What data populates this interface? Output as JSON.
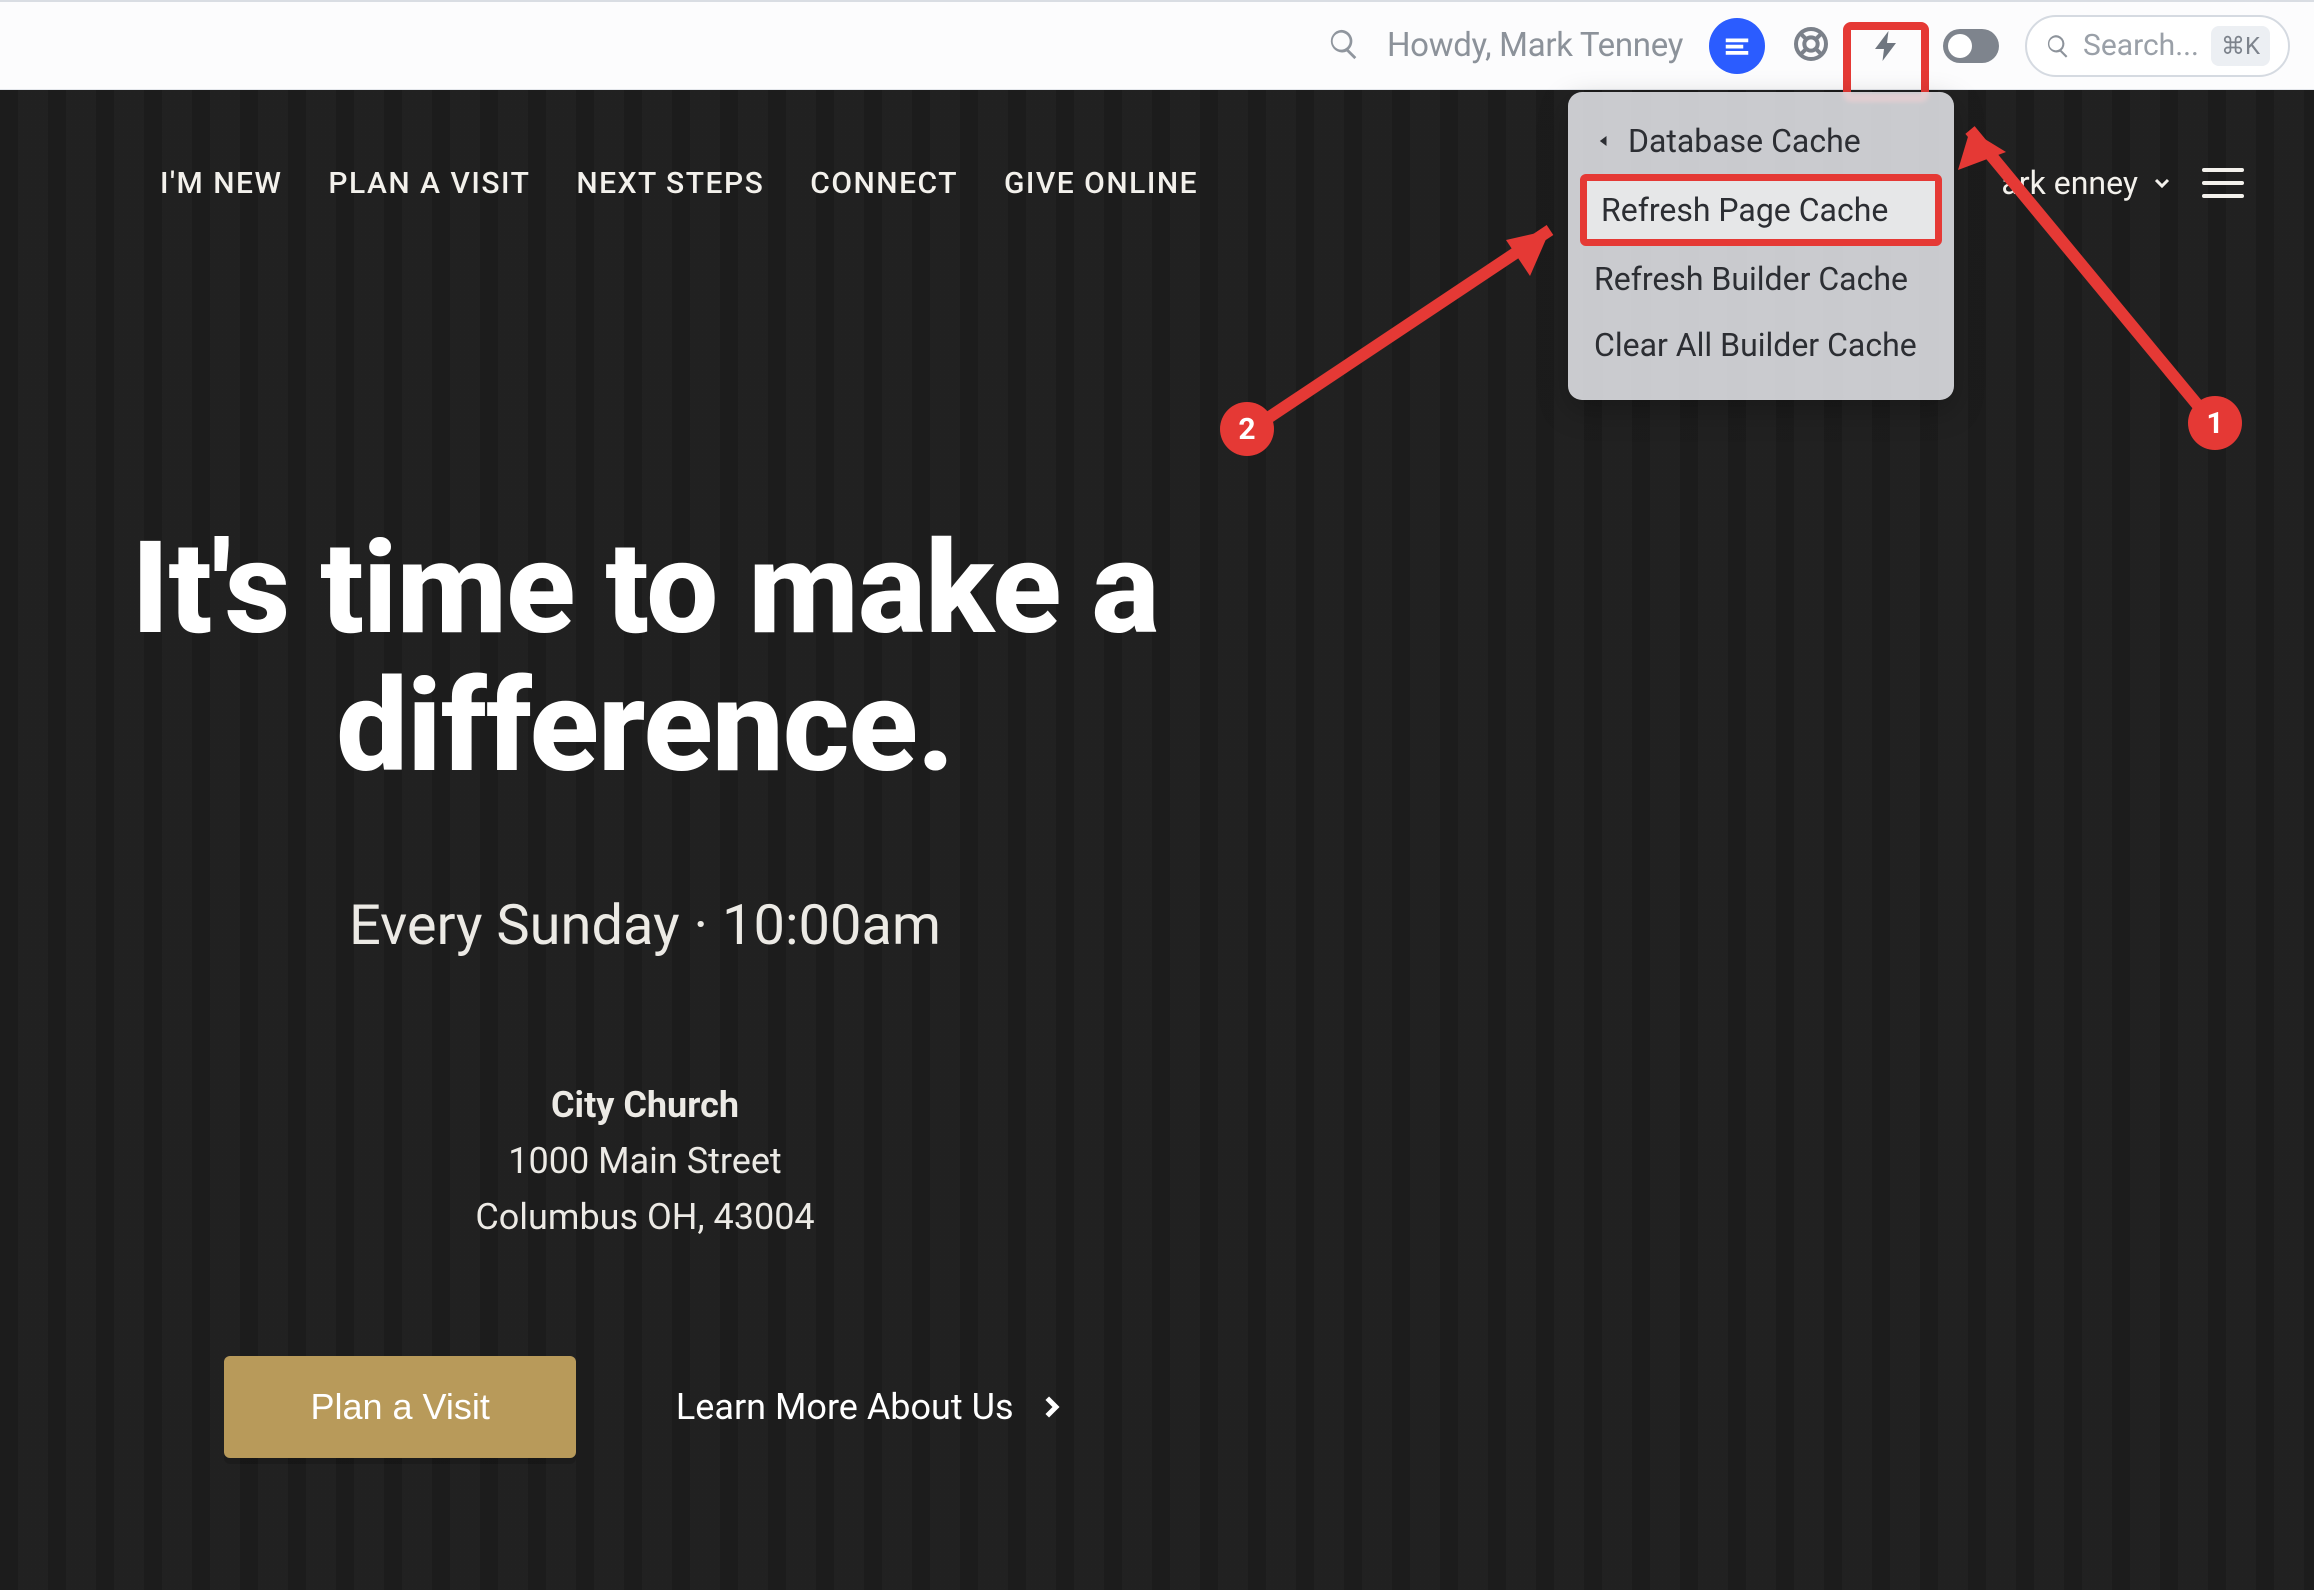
{
  "adminbar": {
    "howdy": "Howdy, Mark Tenney",
    "search_placeholder": "Search...",
    "kbd": "⌘K"
  },
  "dropdown": {
    "back_label": "Database Cache",
    "items": [
      "Refresh Page Cache",
      "Refresh Builder Cache",
      "Clear All Builder Cache"
    ]
  },
  "sitenav": {
    "items": [
      "I'M NEW",
      "PLAN A VISIT",
      "NEXT STEPS",
      "CONNECT",
      "GIVE ONLINE"
    ],
    "user_partial": "ark   enney"
  },
  "hero": {
    "headline": "It's time to make a difference.",
    "subhead": "Every Sunday · 10:00am",
    "church_name": "City Church",
    "addr1": "1000 Main Street",
    "addr2": "Columbus OH, 43004",
    "cta_primary": "Plan a Visit",
    "cta_secondary": "Learn More About Us"
  },
  "annotations": {
    "badge1": "1",
    "badge2": "2"
  }
}
